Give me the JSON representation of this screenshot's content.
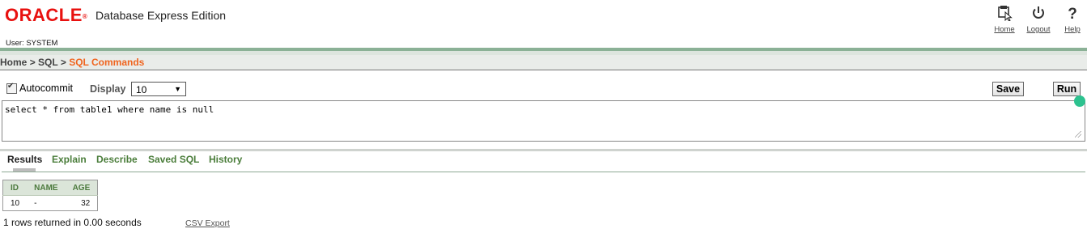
{
  "header": {
    "logo": "ORACLE",
    "logo_mark": "®",
    "product": "Database Express Edition",
    "user": "User: SYSTEM",
    "nav": {
      "home": "Home",
      "logout": "Logout",
      "help": "Help"
    }
  },
  "breadcrumb": {
    "home": "Home",
    "sep": ">",
    "sql": "SQL",
    "current": "SQL Commands"
  },
  "toolbar": {
    "autocommit_label": "Autocommit",
    "autocommit_checked": true,
    "display_label": "Display",
    "display_value": "10",
    "save_label": "Save",
    "run_label": "Run"
  },
  "editor": {
    "query": "select * from table1 where name is null"
  },
  "tabs": [
    {
      "label": "Results",
      "active": true
    },
    {
      "label": "Explain"
    },
    {
      "label": "Describe"
    },
    {
      "label": "Saved SQL"
    },
    {
      "label": "History"
    }
  ],
  "results": {
    "columns": [
      "ID",
      "NAME",
      "AGE"
    ],
    "rows": [
      [
        "10",
        "-",
        "32"
      ]
    ],
    "summary": "1 rows returned in 0.00 seconds",
    "csv_export": "CSV Export"
  },
  "colors": {
    "brand": "#e8110f",
    "breadcrumb_current": "#f0641e",
    "tab_link": "#4a7d3a",
    "header_bar": "#8bb196"
  }
}
